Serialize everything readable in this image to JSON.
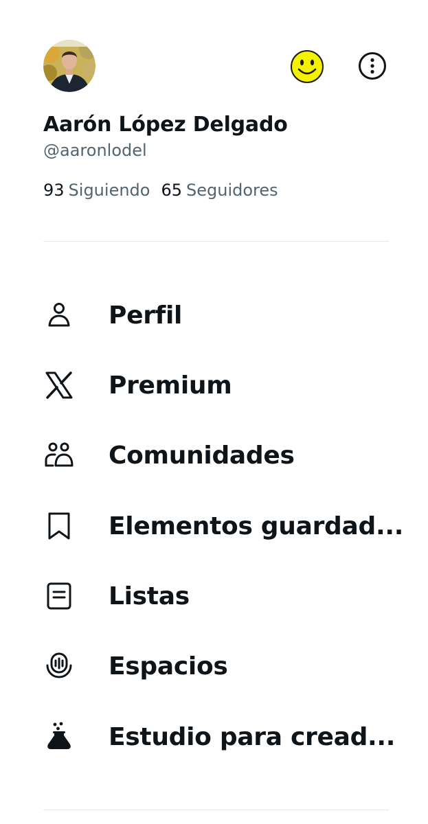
{
  "profile": {
    "display_name": "Aarón López Delgado",
    "handle": "@aaronlodel",
    "following_count": "93",
    "following_label": "Siguiendo",
    "followers_count": "65",
    "followers_label": "Seguidores",
    "avatar_icon": "profile-photo"
  },
  "header_icons": {
    "status_icon": "smiley-face-icon",
    "more_icon": "more-options-icon"
  },
  "menu": {
    "items": [
      {
        "label": "Perfil",
        "icon": "person-icon"
      },
      {
        "label": "Premium",
        "icon": "x-logo-icon"
      },
      {
        "label": "Comunidades",
        "icon": "communities-icon"
      },
      {
        "label": "Elementos guardad...",
        "icon": "bookmark-icon"
      },
      {
        "label": "Listas",
        "icon": "list-icon"
      },
      {
        "label": "Espacios",
        "icon": "spaces-icon"
      },
      {
        "label": "Estudio para cread...",
        "icon": "creator-studio-icon"
      }
    ]
  },
  "colors": {
    "text_primary": "#0f1419",
    "text_secondary": "#536471",
    "divider": "#e6e8ea",
    "smiley_yellow": "#f5f200"
  }
}
